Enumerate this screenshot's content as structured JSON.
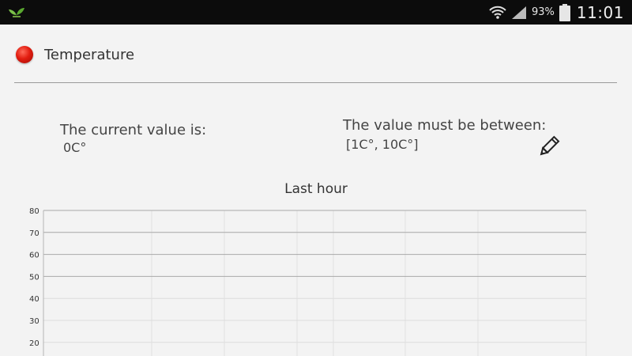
{
  "status_bar": {
    "app_icon": "leaf-icon",
    "wifi_icon": "wifi-icon",
    "signal_icon": "signal-icon",
    "battery_percent": "93%",
    "battery_icon": "battery-icon",
    "time": "11:01"
  },
  "sensor": {
    "status_color": "#e21d10",
    "title": "Temperature"
  },
  "current": {
    "label": "The current value is:",
    "value": "0C°"
  },
  "range": {
    "label": "The value must be between:",
    "value": "[1C°, 10C°]",
    "edit_icon": "pencil-icon"
  },
  "chart_data": {
    "type": "line",
    "title": "Last hour",
    "y_ticks": [
      "80",
      "70",
      "60",
      "50",
      "40",
      "30",
      "20"
    ],
    "ylim": [
      20,
      80
    ],
    "series": [],
    "grid": true
  }
}
